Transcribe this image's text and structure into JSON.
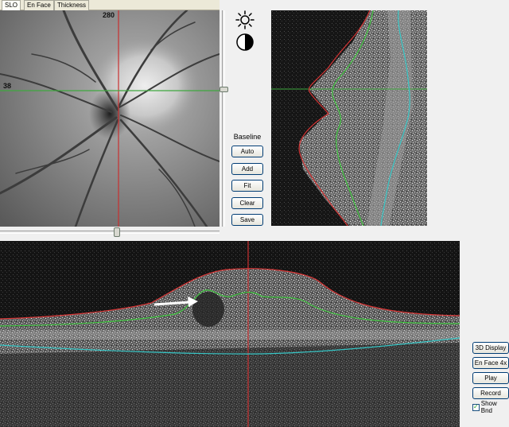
{
  "tabs": [
    {
      "label": "SLO",
      "active": true
    },
    {
      "label": "En Face",
      "active": false
    },
    {
      "label": "Thickness",
      "active": false
    }
  ],
  "slo": {
    "column_marker": "280",
    "row_marker": "38"
  },
  "icons": {
    "brightness": "sun-icon",
    "contrast": "contrast-icon"
  },
  "baseline": {
    "title": "Baseline",
    "buttons": [
      "Auto",
      "Add",
      "Fit",
      "Clear",
      "Save"
    ]
  },
  "controls": {
    "buttons": [
      "3D Display",
      "En Face 4x",
      "Play",
      "Record"
    ],
    "show_bnd_label": "Show Bnd",
    "show_bnd_checked": true
  },
  "colors": {
    "crosshair_vertical": "#c83030",
    "crosshair_horizontal": "#3fa83f",
    "ilm_boundary": "#d63434",
    "rpe_boundary": "#3ec43e",
    "bruch_boundary": "#36c6c6",
    "arrow": "#ffffff"
  }
}
